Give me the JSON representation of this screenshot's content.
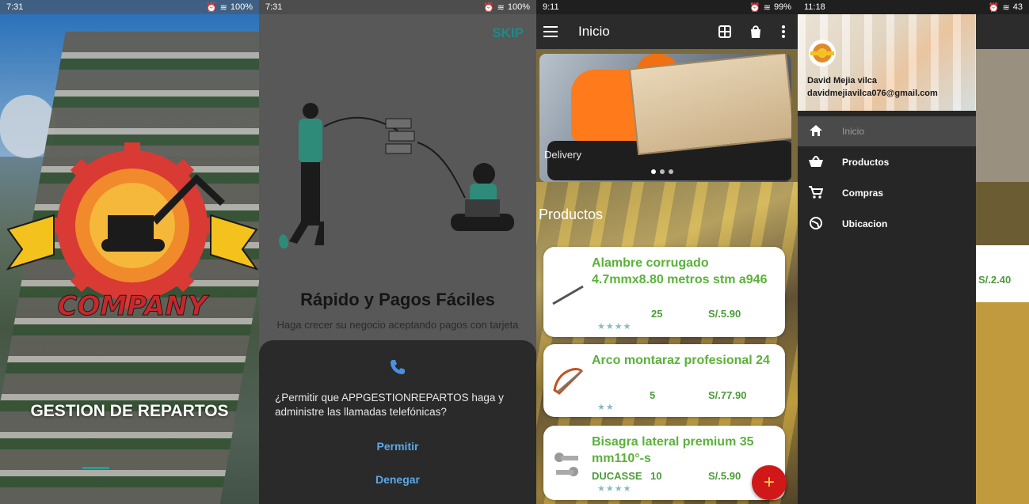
{
  "splash": {
    "status_time": "7:31",
    "status_battery": "100%",
    "logo_text": "COMPANY",
    "title": "GESTION DE REPARTOS"
  },
  "onboarding": {
    "status_time": "7:31",
    "status_battery": "100%",
    "skip_label": "SKIP",
    "title": "Rápido y Pagos Fáciles",
    "subtitle": "Haga crecer su negocio aceptando pagos con tarjeta",
    "dialog": {
      "message": "¿Permitir que APPGESTIONREPARTOS haga y administre las llamadas telefónicas?",
      "allow_label": "Permitir",
      "deny_label": "Denegar"
    }
  },
  "home": {
    "status_time": "9:11",
    "status_battery": "99%",
    "title": "Inicio",
    "banner_caption": "Delivery",
    "section_title": "Productos",
    "products": [
      {
        "name": "Alambre corrugado 4.7mmx8.80 metros stm a946",
        "brand": "",
        "qty": "25",
        "price": "S/.5.90",
        "stars": "★★★★",
        "icon": "wire-icon"
      },
      {
        "name": "Arco montaraz profesional 24",
        "brand": "",
        "qty": "5",
        "price": "S/.77.90",
        "stars": "★★",
        "icon": "saw-icon"
      },
      {
        "name": "Bisagra lateral premium 35 mm110°-s",
        "brand": "DUCASSE",
        "qty": "10",
        "price": "S/.5.90",
        "stars": "★★★★",
        "icon": "hinge-icon"
      }
    ],
    "fab_label": "+"
  },
  "drawer": {
    "status_time": "11:18",
    "status_battery": "43",
    "user_name": "David Mejia vilca",
    "user_email": "davidmejiavilca076@gmail.com",
    "items": [
      {
        "label": "Inicio",
        "icon": "home-icon",
        "selected": true
      },
      {
        "label": "Productos",
        "icon": "basket-icon",
        "selected": false
      },
      {
        "label": "Compras",
        "icon": "cart-icon",
        "selected": false
      },
      {
        "label": "Ubicacion",
        "icon": "globe-icon",
        "selected": false
      }
    ],
    "behind_price": "S/.2.40"
  },
  "colors": {
    "accent_teal": "#1f8a86",
    "product_green": "#5ab23a",
    "fab_red": "#d01818",
    "dialog_blue": "#5aa8e8"
  }
}
